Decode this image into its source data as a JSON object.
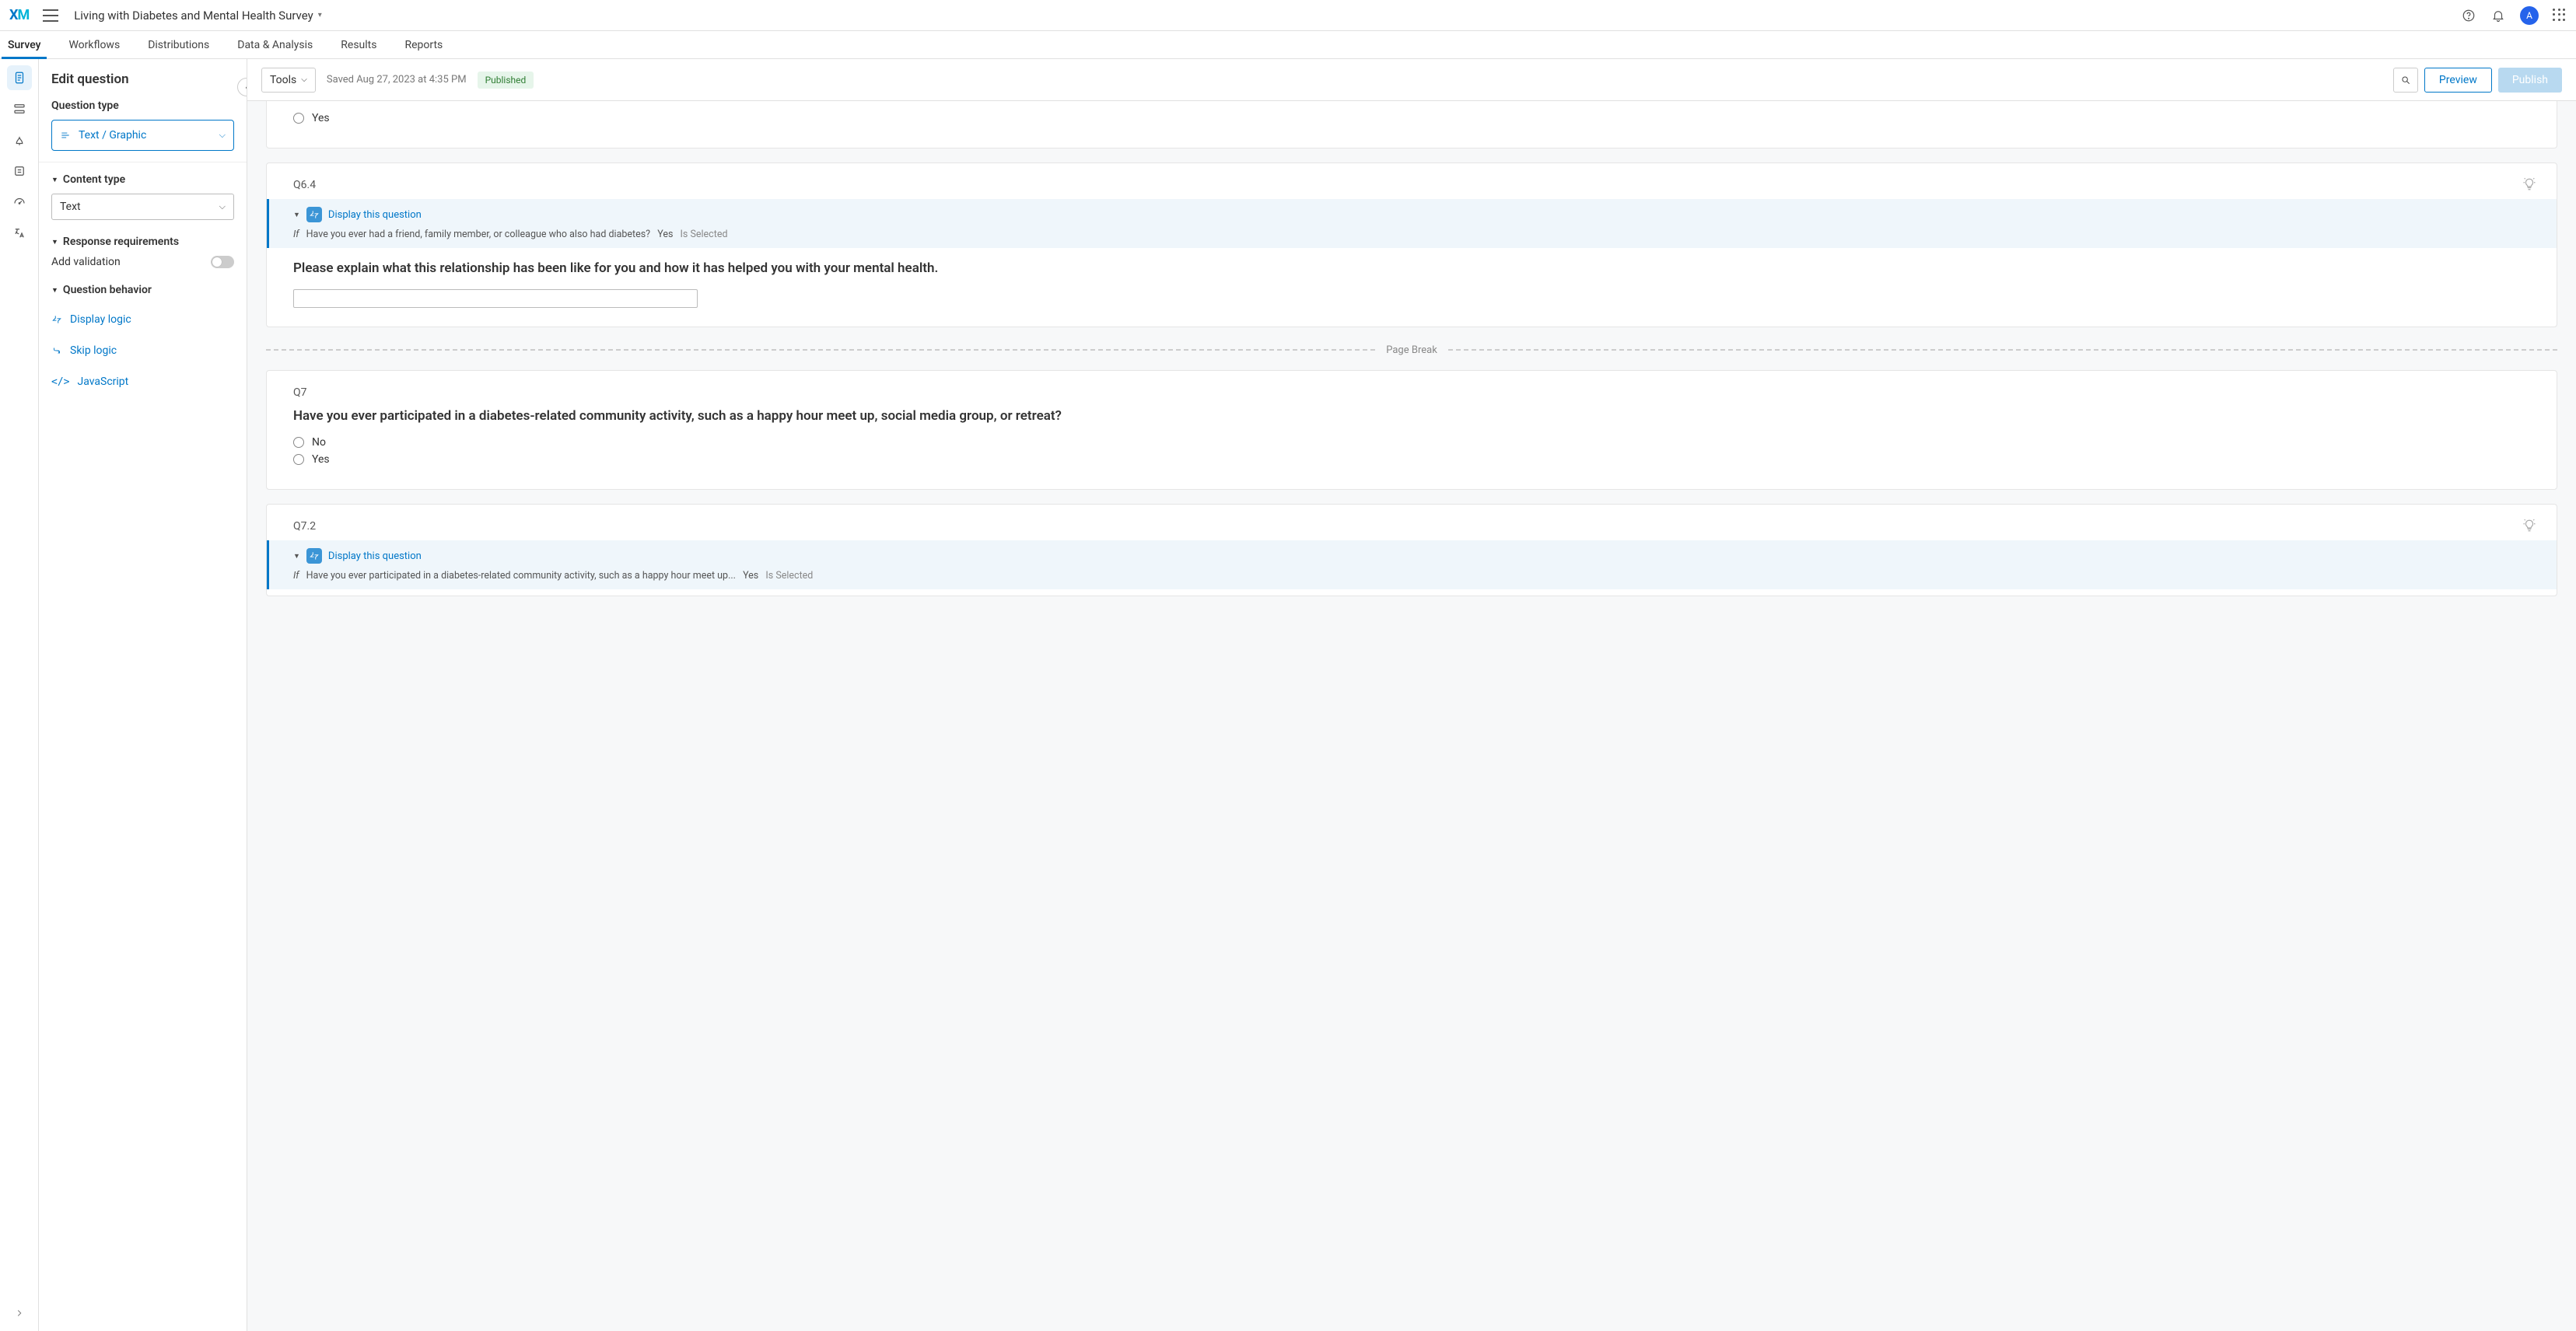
{
  "header": {
    "logo_text": "XM",
    "project_title": "Living with Diabetes and Mental Health Survey",
    "avatar_initial": "A"
  },
  "tabs": {
    "items": [
      "Survey",
      "Workflows",
      "Distributions",
      "Data & Analysis",
      "Results",
      "Reports"
    ],
    "active_index": 0
  },
  "edit_panel": {
    "title": "Edit question",
    "question_type_label": "Question type",
    "question_type_value": "Text / Graphic",
    "content_type_label": "Content type",
    "content_type_value": "Text",
    "response_req_label": "Response requirements",
    "add_validation_label": "Add validation",
    "add_validation_on": false,
    "question_behavior_label": "Question behavior",
    "behavior_links": {
      "display_logic": "Display logic",
      "skip_logic": "Skip logic",
      "javascript": "JavaScript"
    }
  },
  "canvas_toolbar": {
    "tools_label": "Tools",
    "saved_text": "Saved Aug 27, 2023 at 4:35 PM",
    "published_badge": "Published",
    "preview_label": "Preview",
    "publish_label": "Publish"
  },
  "questions": {
    "partial_top_option": "Yes",
    "q64": {
      "number": "Q6.4",
      "display_this_question": "Display this question",
      "cond_if": "If",
      "cond_text": "Have you ever had a friend, family member, or colleague who also had diabetes?",
      "cond_answer": "Yes",
      "cond_state": "Is Selected",
      "text": "Please explain what this relationship has been like for you and how it has helped you with your mental health."
    },
    "page_break": "Page Break",
    "q7": {
      "number": "Q7",
      "text": "Have you ever participated in a diabetes-related community activity, such as a happy hour meet up, social media group, or retreat?",
      "options": [
        "No",
        "Yes"
      ]
    },
    "q72": {
      "number": "Q7.2",
      "display_this_question": "Display this question",
      "cond_if": "If",
      "cond_text": "Have you ever participated in a diabetes-related community activity, such as a happy hour meet up...",
      "cond_answer": "Yes",
      "cond_state": "Is Selected"
    }
  }
}
